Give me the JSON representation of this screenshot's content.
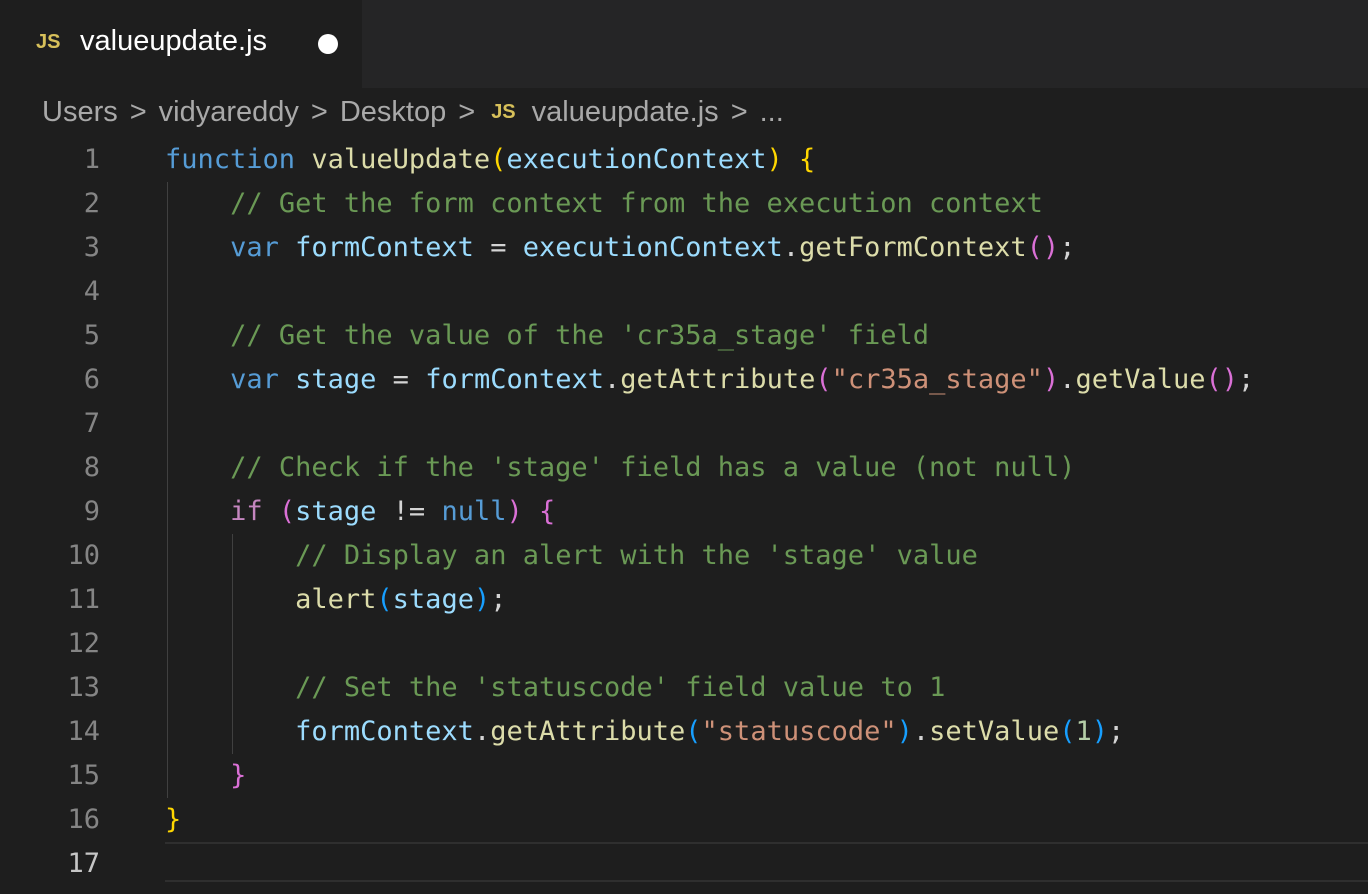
{
  "tab": {
    "icon_label": "JS",
    "filename": "valueupdate.js",
    "unsaved": true
  },
  "breadcrumb": {
    "items": [
      "Users",
      "vidyareddy",
      "Desktop",
      "valueupdate.js",
      "..."
    ],
    "separator": ">",
    "file_icon_label": "JS"
  },
  "editor": {
    "language": "javascript",
    "active_line": 17,
    "line_numbers": [
      "1",
      "2",
      "3",
      "4",
      "5",
      "6",
      "7",
      "8",
      "9",
      "10",
      "11",
      "12",
      "13",
      "14",
      "15",
      "16",
      "17"
    ],
    "lines": [
      "function valueUpdate(executionContext) {",
      "    // Get the form context from the execution context",
      "    var formContext = executionContext.getFormContext();",
      "",
      "    // Get the value of the 'cr35a_stage' field",
      "    var stage = formContext.getAttribute(\"cr35a_stage\").getValue();",
      "",
      "    // Check if the 'stage' field has a value (not null)",
      "    if (stage != null) {",
      "        // Display an alert with the 'stage' value",
      "        alert(stage);",
      "",
      "        // Set the 'statuscode' field value to 1",
      "        formContext.getAttribute(\"statuscode\").setValue(1);",
      "    }",
      "}",
      ""
    ]
  },
  "colors": {
    "background": "#1e1e1e",
    "keyword": "#569cd6",
    "control": "#c586c0",
    "function": "#dcdcaa",
    "variable": "#9cdcfe",
    "comment": "#6a9955",
    "string": "#ce9178",
    "number": "#b5cea8",
    "js_icon": "#d7c05a"
  }
}
